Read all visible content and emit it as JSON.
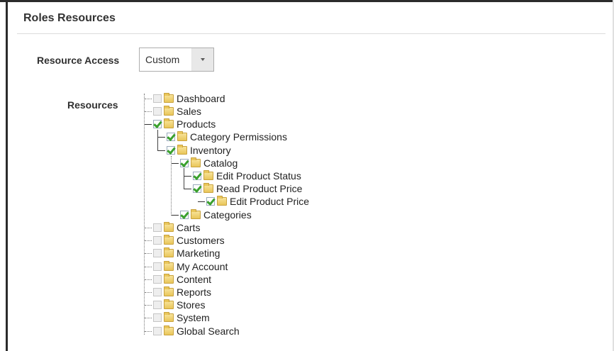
{
  "section": {
    "title": "Roles Resources"
  },
  "resource_access": {
    "label": "Resource Access",
    "value": "Custom"
  },
  "resources": {
    "label": "Resources",
    "tree": [
      {
        "label": "Dashboard",
        "checked": false
      },
      {
        "label": "Sales",
        "checked": false
      },
      {
        "label": "Products",
        "checked": true
      },
      {
        "label": "Category Permissions",
        "checked": true
      },
      {
        "label": "Inventory",
        "checked": true
      },
      {
        "label": "Catalog",
        "checked": true
      },
      {
        "label": "Edit Product Status",
        "checked": true
      },
      {
        "label": "Read Product Price",
        "checked": true
      },
      {
        "label": "Edit Product Price",
        "checked": true
      },
      {
        "label": "Categories",
        "checked": true
      },
      {
        "label": "Carts",
        "checked": false
      },
      {
        "label": "Customers",
        "checked": false
      },
      {
        "label": "Marketing",
        "checked": false
      },
      {
        "label": "My Account",
        "checked": false
      },
      {
        "label": "Content",
        "checked": false
      },
      {
        "label": "Reports",
        "checked": false
      },
      {
        "label": "Stores",
        "checked": false
      },
      {
        "label": "System",
        "checked": false
      },
      {
        "label": "Global Search",
        "checked": false
      }
    ]
  },
  "colors": {
    "check": "#3aa12e",
    "folder": "#e9c65a"
  }
}
